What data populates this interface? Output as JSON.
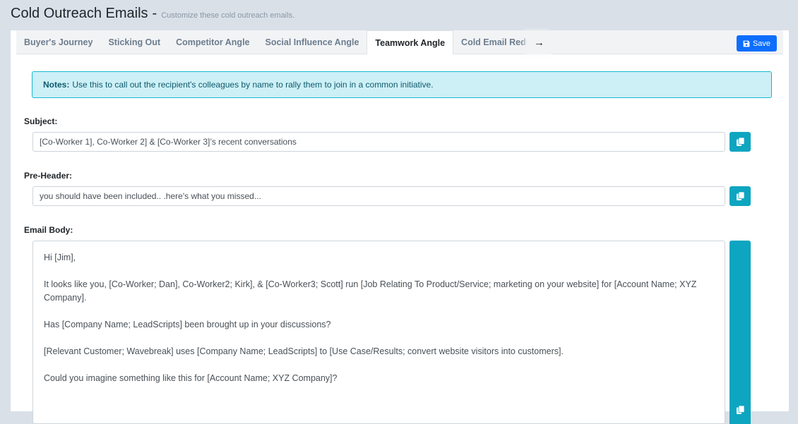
{
  "header": {
    "title": "Cold Outreach Emails",
    "separator": "-",
    "subtitle": "Customize these cold outreach emails."
  },
  "tabs": [
    {
      "label": "Buyer's Journey",
      "active": false
    },
    {
      "label": "Sticking Out",
      "active": false
    },
    {
      "label": "Competitor Angle",
      "active": false
    },
    {
      "label": "Social Influence Angle",
      "active": false
    },
    {
      "label": "Teamwork Angle",
      "active": true
    },
    {
      "label": "Cold Email Redi",
      "active": false
    }
  ],
  "tab_scroll_icon": "arrow-right-icon",
  "toolbar": {
    "save_label": "Save",
    "save_icon": "floppy-disk-icon",
    "save_color": "#0d6efd"
  },
  "notes": {
    "label": "Notes:",
    "text": "Use this to call out the recipient's colleagues by name to rally them to join in a common initiative."
  },
  "subject": {
    "label": "Subject:",
    "value": "[Co-Worker 1], Co-Worker 2] & [Co-Worker 3]’s recent conversations"
  },
  "preheader": {
    "label": "Pre-Header:",
    "value": "you should have been included.. .here's what you missed..."
  },
  "email_body": {
    "label": "Email Body:",
    "paragraphs": [
      "Hi [Jim],",
      "It looks like you, [Co-Worker; Dan], Co-Worker2; Kirk], & [Co-Worker3; Scott] run [Job Relating To Product/Service; marketing on your website] for [Account Name; XYZ Company].",
      "Has [Company Name; LeadScripts] been brought up in your discussions?",
      "[Relevant Customer; Wavebreak] uses [Company Name; LeadScripts] to [Use Case/Results; convert website visitors into customers].",
      "Could you imagine something like this for [Account Name; XYZ Company]?"
    ]
  },
  "copy_icon": "copy-icon",
  "colors": {
    "accent": "#0ea5c0",
    "notes_bg": "#cdf0f7",
    "notes_border": "#16b8d2"
  }
}
